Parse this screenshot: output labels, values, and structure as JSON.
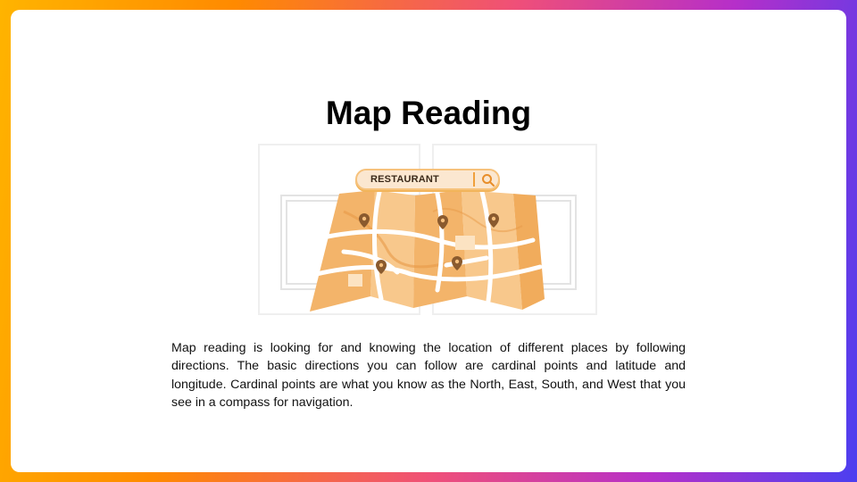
{
  "slide": {
    "title": "Map Reading",
    "search_label": "RESTAURANT",
    "description": "Map reading is looking for and knowing the location of different places by following directions. The basic directions you can follow are cardinal points and latitude and longitude. Cardinal points are what you know as the North, East, South, and West that you see in a compass for navigation."
  },
  "icons": {
    "search": "search-icon",
    "pin": "map-pin-icon",
    "map": "folded-map-illustration"
  },
  "colors": {
    "map_fill": "#f6c07e",
    "map_fill_dark": "#efac5c",
    "road": "#ffffff",
    "pin": "#8a5a2e",
    "search_bg": "#fbe7d0",
    "search_border": "#f6c27c"
  }
}
